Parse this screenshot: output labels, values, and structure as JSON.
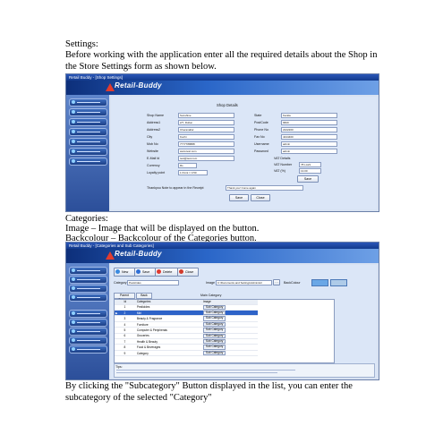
{
  "doc": {
    "settings_title": "Settings:",
    "settings_body": "Before working with the application enter all the required details about the Shop in the Store Settings form as shown below.",
    "categories_title": "Categories:",
    "image_def": "Image – Image that will be displayed on the button.",
    "backcolour_def": "Backcolour – Backcolour of the  Categories button.",
    "subcategory_note": "By clicking the \"Subcategory\" Button displayed in the list, you can enter the subcategory of the selected \"Category\""
  },
  "settings_form": {
    "window_title": "Retail Buddy - [Shop Settings]",
    "brand": "Retail-Buddy",
    "section_title": "Shop Details",
    "left_fields": [
      {
        "label": "Shop Name",
        "value": "Sunshine"
      },
      {
        "label": "Address1",
        "value": "2/7, Dubai"
      },
      {
        "label": "Address2",
        "value": "Cheranallur"
      },
      {
        "label": "City",
        "value": "Kochi"
      },
      {
        "label": "Mob No",
        "value": "7777788888"
      },
      {
        "label": "Website",
        "value": "www.test.com"
      },
      {
        "label": "E-Mail Id",
        "value": "test@test.com"
      },
      {
        "label": "Currency",
        "value": "Rs"
      },
      {
        "label": "Loyalty point",
        "value": "1 Point = 0.50"
      }
    ],
    "right_fields": [
      {
        "label": "State",
        "value": "Kerala"
      },
      {
        "label": "PostCode",
        "value": "6820"
      },
      {
        "label": "Phone No",
        "value": "2222200"
      },
      {
        "label": "Fax No",
        "value": "4444400"
      },
      {
        "label": "Username",
        "value": "admin"
      },
      {
        "label": "Password",
        "value": "admin"
      }
    ],
    "vat_title": "VAT Details",
    "vat_fields": [
      {
        "label": "VAT Number",
        "value": "78 LA21"
      },
      {
        "label": "VAT (%)",
        "value": "13.00"
      }
    ],
    "save_label": "Save",
    "receipt_label": "Thankyou Note to appear in the Receipt",
    "receipt_value": "Thank you! Come again",
    "footer_save": "Save",
    "footer_close": "Close"
  },
  "categories_form": {
    "window_title": "Retail Buddy - [Categories and Sub Categories]",
    "brand": "Retail-Buddy",
    "toolbar": [
      "New",
      "Save",
      "Delete",
      "Close"
    ],
    "category_label": "Category",
    "category_value": "Pesticides",
    "image_label": "Image",
    "image_value": "C:\\Documents and Settings\\Administr",
    "backcolor_label": "BackColour",
    "parent_tab": "Parent Category",
    "back_tab": "Back",
    "table_title": "Main Category",
    "columns": [
      "Id",
      "Categories",
      "Image",
      ""
    ],
    "rows": [
      {
        "id": "1",
        "name": "Pesticides",
        "sub": "Sub Category"
      },
      {
        "id": "2",
        "name": "Mbl",
        "sub": "Sub Category"
      },
      {
        "id": "3",
        "name": "Beauty & Fragrance",
        "sub": "Sub Category"
      },
      {
        "id": "4",
        "name": "Furniture",
        "sub": "Sub Category"
      },
      {
        "id": "5",
        "name": "Computer & Peripherals",
        "sub": "Sub Category"
      },
      {
        "id": "6",
        "name": "Groceries",
        "sub": "Sub Category"
      },
      {
        "id": "7",
        "name": "Health & Beauty",
        "sub": "Sub Category"
      },
      {
        "id": "8",
        "name": "Food & Beverages",
        "sub": "Sub Category"
      },
      {
        "id": "9",
        "name": "Category",
        "sub": "Sub Category"
      }
    ],
    "tips_title": "Tips:"
  },
  "colors": {
    "window_blue": "#2a56b8",
    "panel": "#dbe6f7",
    "selected_row": "#2e63c8"
  }
}
